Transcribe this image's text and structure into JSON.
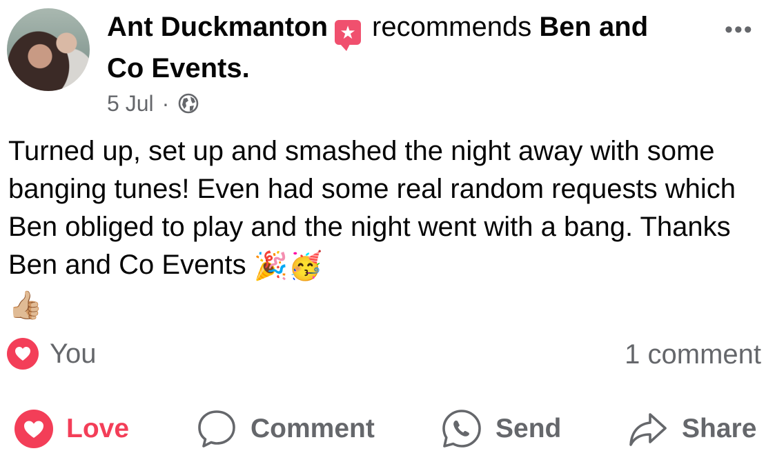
{
  "post": {
    "author": "Ant Duckmanton",
    "verb": "recommends",
    "page": "Ben and Co Events.",
    "timestamp": "5 Jul",
    "separator": "·",
    "audience_icon": "globe-icon",
    "more_icon": "more-options-icon",
    "more_label": "•••",
    "body": "Turned up, set up and smashed the night away with some banging tunes! Even had some real random requests which Ben obliged to play and the night went with a bang. Thanks Ben and Co Events",
    "body_emojis": [
      "🎉",
      "🥳",
      "👍🏼"
    ]
  },
  "reactions": {
    "icon": "love-reaction-icon",
    "summary": "You",
    "comment_count": "1 comment"
  },
  "actions": {
    "love": "Love",
    "comment": "Comment",
    "send": "Send",
    "share": "Share"
  },
  "colors": {
    "love_red": "#f33e58",
    "recommend_pink": "#f0506e",
    "secondary_text": "#65676b",
    "primary_text": "#050505"
  }
}
